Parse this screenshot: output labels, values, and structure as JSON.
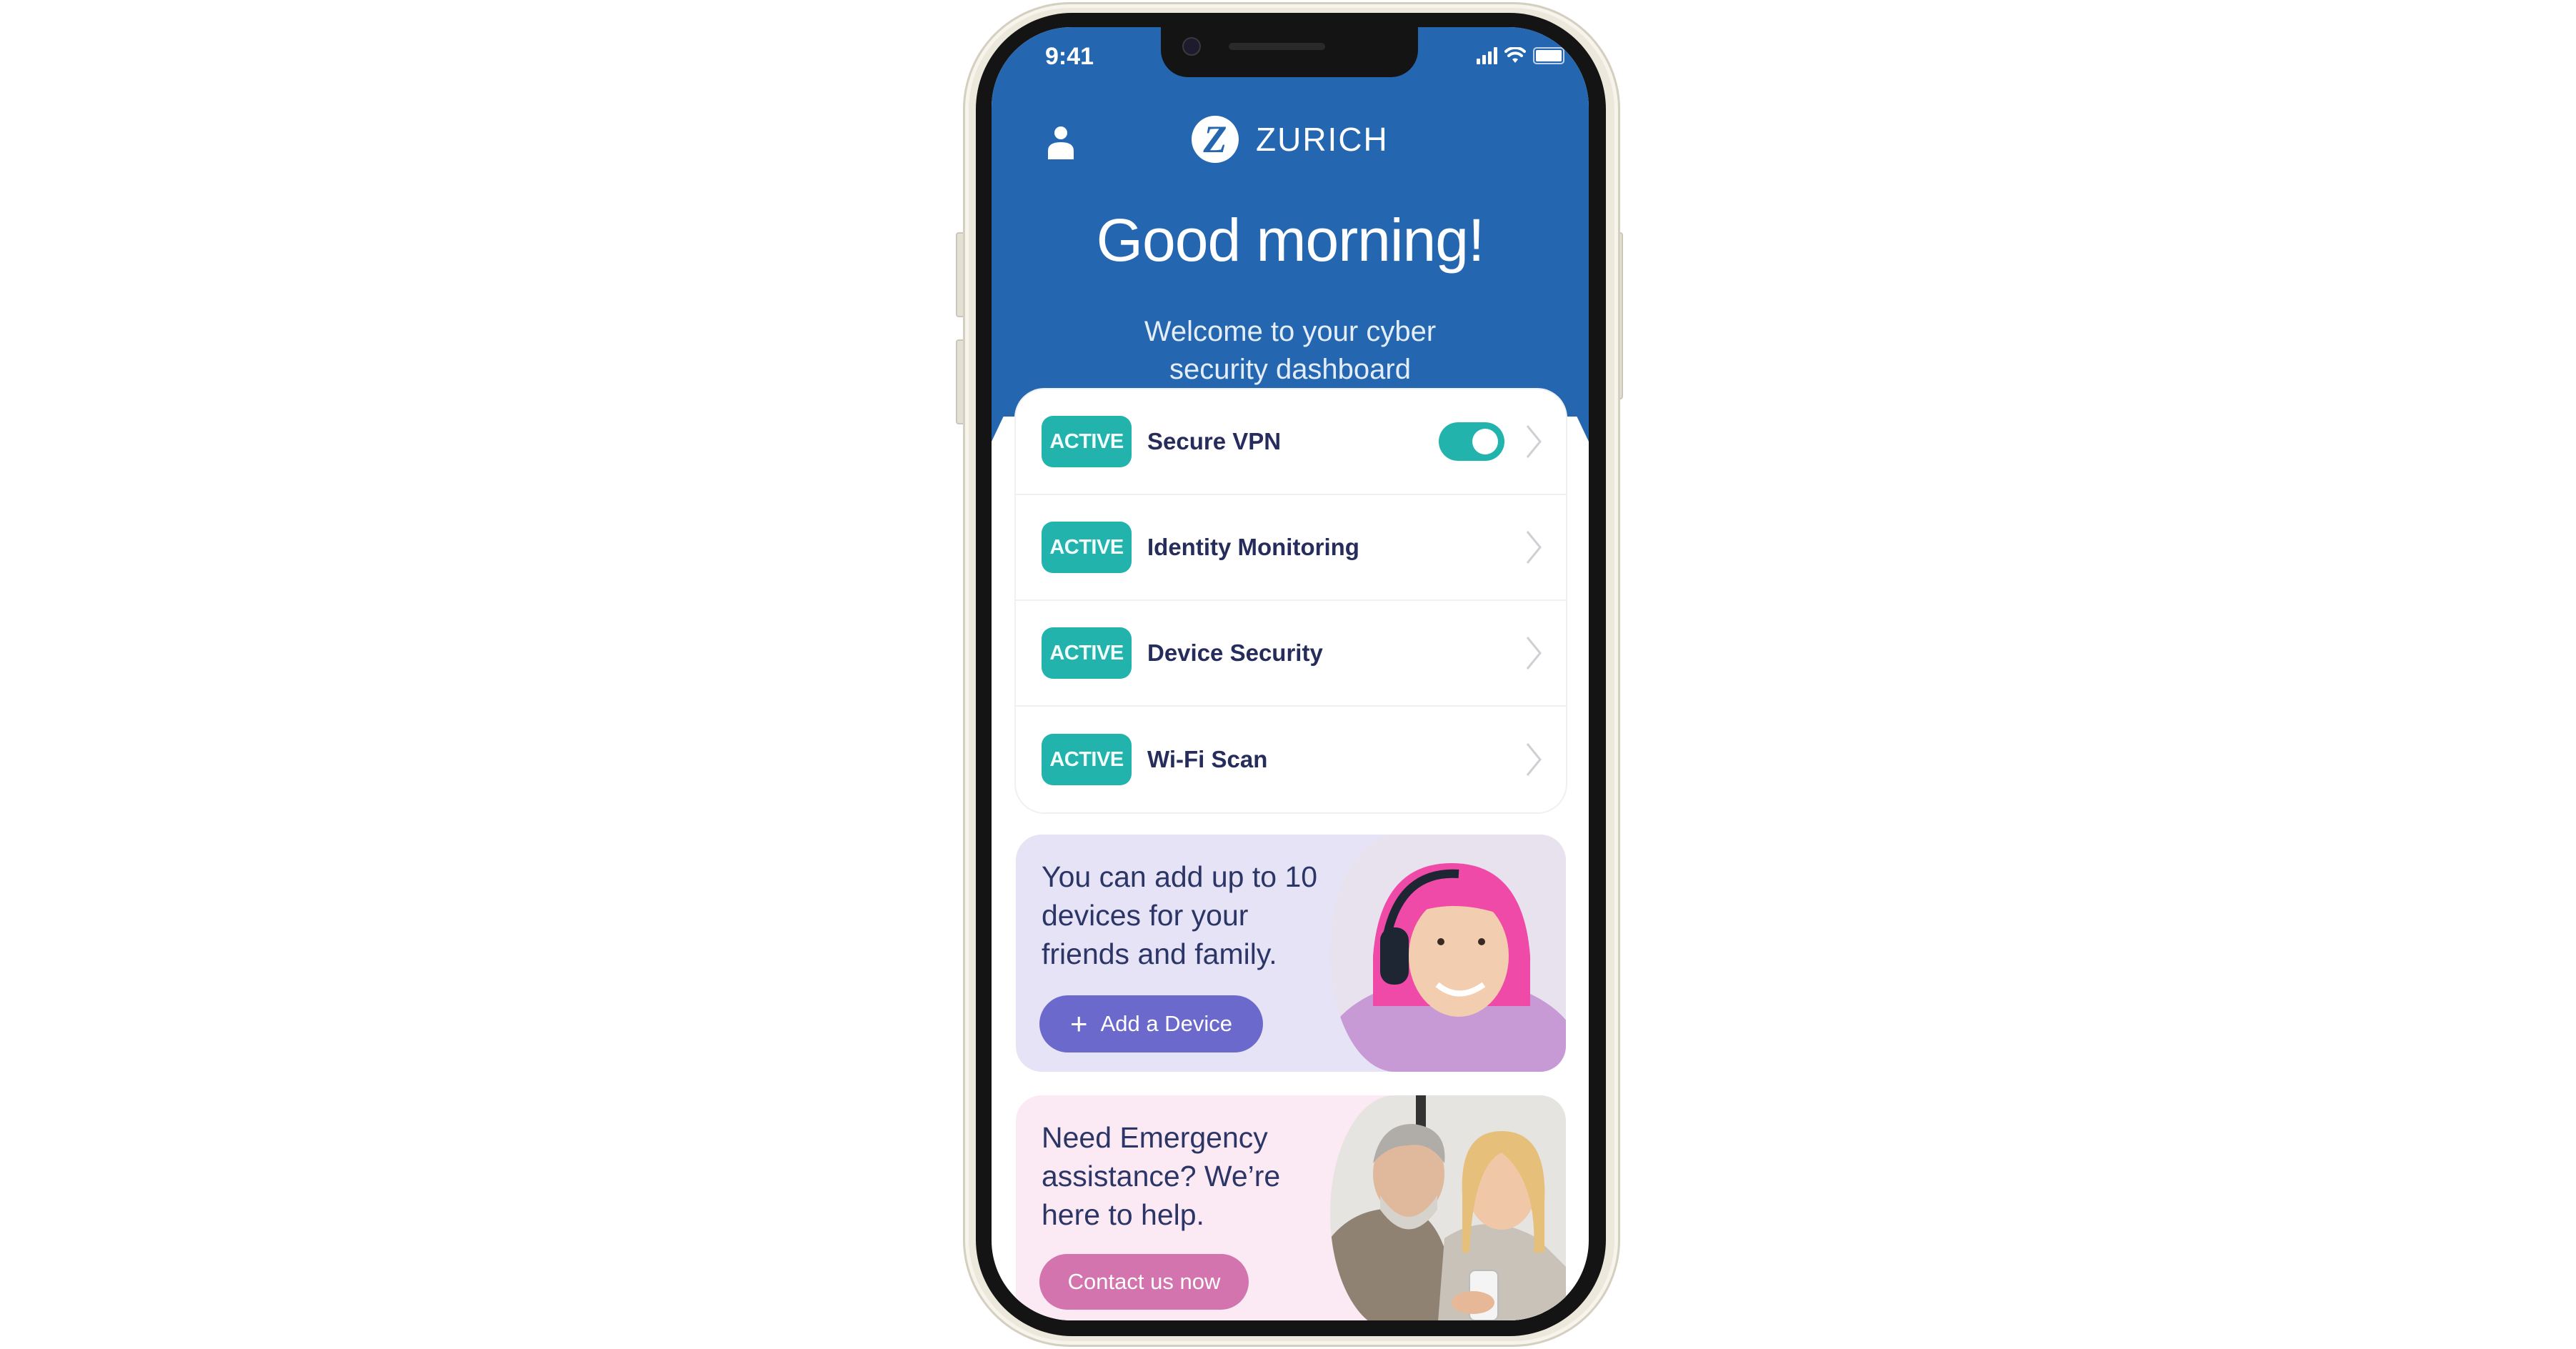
{
  "status_bar": {
    "time": "9:41",
    "icons": [
      "cellular-signal-icon",
      "wifi-icon",
      "battery-icon"
    ]
  },
  "header": {
    "profile_icon": "person-icon",
    "logo_mark": "Z",
    "logo_text": "ZURICH",
    "greeting": "Good morning!",
    "subtitle_line1": "Welcome to your cyber",
    "subtitle_line2": "security dashboard"
  },
  "colors": {
    "header_blue": "#2467b0",
    "active_teal": "#22b3ad",
    "text_navy": "#262d5c",
    "promo1_bg": "#e5e3f5",
    "promo1_button": "#6b69cc",
    "promo2_bg": "#fbe9f3",
    "promo2_button": "#d474ae"
  },
  "services": [
    {
      "status": "ACTIVE",
      "label": "Secure VPN",
      "toggle": true,
      "toggle_on": true
    },
    {
      "status": "ACTIVE",
      "label": "Identity Monitoring",
      "toggle": false
    },
    {
      "status": "ACTIVE",
      "label": "Device Security",
      "toggle": false
    },
    {
      "status": "ACTIVE",
      "label": "Wi-Fi Scan",
      "toggle": false
    }
  ],
  "promo_devices": {
    "line1": "You can add up to 10",
    "line2": "devices for your",
    "line3": "friends and family.",
    "button_icon": "+",
    "button_label": "Add a Device",
    "image": "woman-with-pink-hair-wearing-headphones"
  },
  "promo_emergency": {
    "line1": "Need Emergency",
    "line2": "assistance? We’re",
    "line3": "here to help.",
    "button_label": "Contact us now",
    "image": "couple-looking-at-smartphone"
  }
}
